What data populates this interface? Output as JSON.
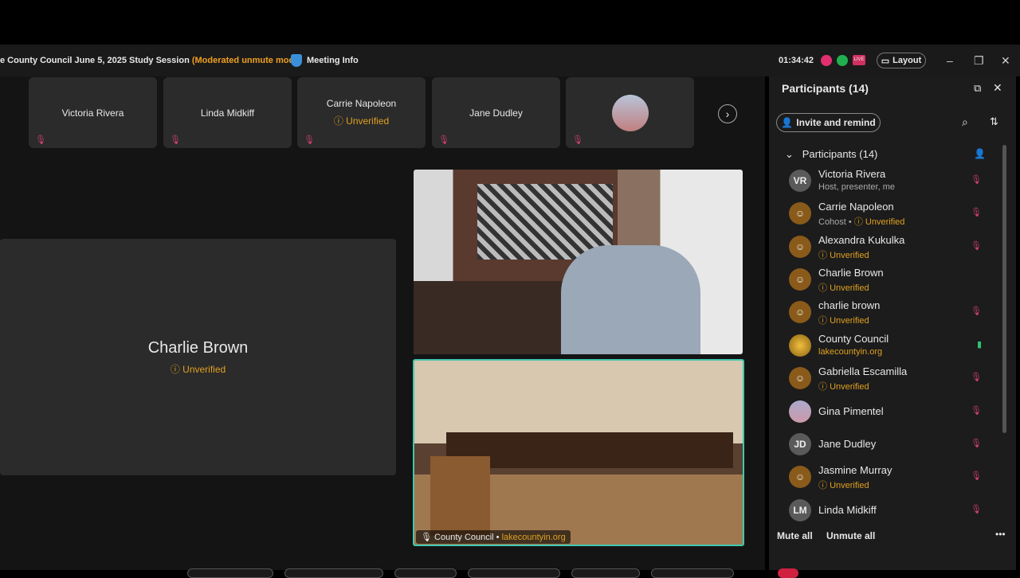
{
  "header": {
    "title": "e County Council June 5, 2025 Study Session",
    "mode": "(Moderated unmute mode)",
    "meeting_info": "Meeting Info",
    "timer": "01:34:42",
    "layout": "Layout",
    "live": "LIVE"
  },
  "thumbs": [
    {
      "name": "Victoria Rivera"
    },
    {
      "name": "Linda Midkiff"
    },
    {
      "name": "Carrie Napoleon",
      "status": "Unverified"
    },
    {
      "name": "Jane Dudley"
    }
  ],
  "stage": {
    "name": "Charlie Brown",
    "status": "Unverified"
  },
  "video2": {
    "name": "County Council",
    "org": "lakecountyin.org"
  },
  "panel": {
    "title": "Participants (14)",
    "invite": "Invite and remind",
    "group": "Participants (14)",
    "mute_all": "Mute all",
    "unmute_all": "Unmute all",
    "participants": [
      {
        "initials": "VR",
        "name": "Victoria Rivera",
        "sub": "Host, presenter, me"
      },
      {
        "name": "Carrie Napoleon",
        "role": "Cohost",
        "sub": "Unverified"
      },
      {
        "name": "Alexandra Kukulka",
        "sub": "Unverified"
      },
      {
        "name": "Charlie Brown",
        "sub": "Unverified"
      },
      {
        "name": "charlie brown",
        "sub": "Unverified"
      },
      {
        "name": "County Council",
        "sub": "lakecountyin.org"
      },
      {
        "name": "Gabriella Escamilla",
        "sub": "Unverified"
      },
      {
        "name": "Gina Pimentel"
      },
      {
        "initials": "JD",
        "name": "Jane Dudley"
      },
      {
        "name": "Jasmine Murray",
        "sub": "Unverified"
      },
      {
        "initials": "LM",
        "name": "Linda Midkiff"
      }
    ]
  }
}
